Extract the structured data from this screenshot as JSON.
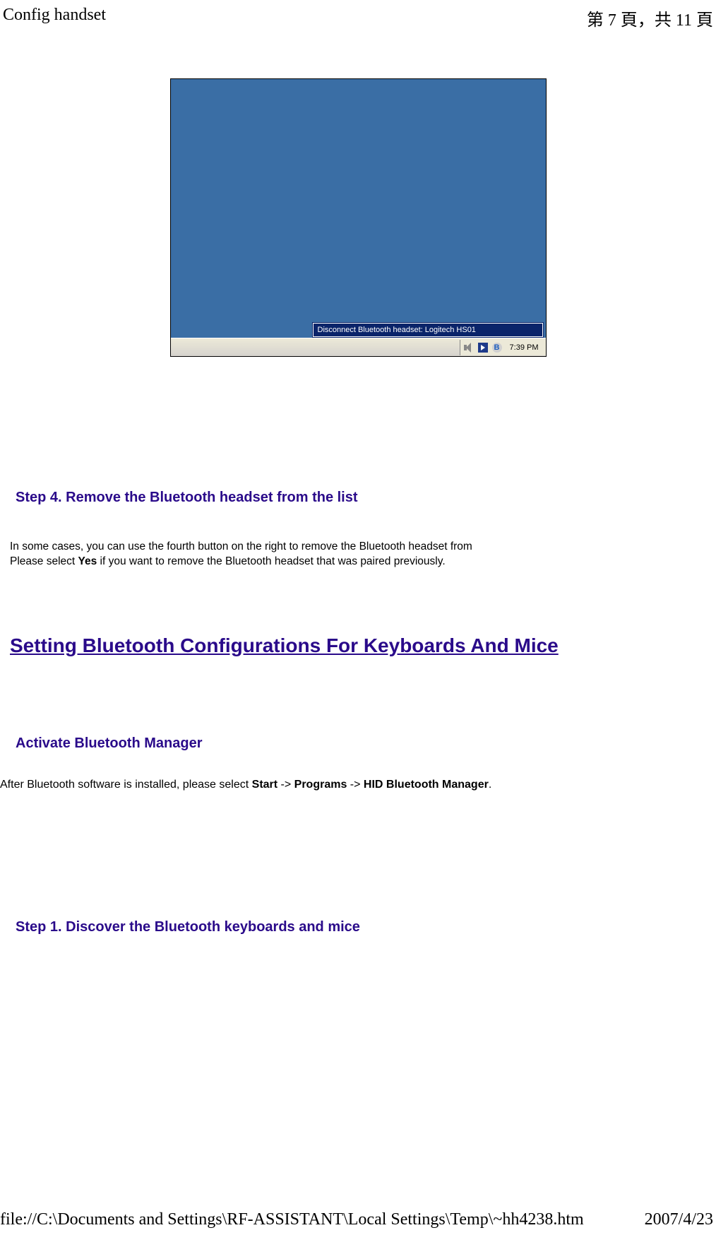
{
  "header": {
    "title": "Config handset",
    "page_indicator": "第 7 頁，共 11 頁"
  },
  "screenshot": {
    "tooltip": "Disconnect Bluetooth headset: Logitech HS01",
    "clock": "7:39 PM"
  },
  "step4": {
    "heading": "Step 4. Remove the Bluetooth headset from the list",
    "text_before_bold": "In some cases, you can use the fourth button on the right to remove the Bluetooth headset from",
    "text_line2_prefix": "Please select ",
    "text_bold": "Yes",
    "text_line2_suffix": " if you want to remove the Bluetooth headset that was paired previously."
  },
  "main_heading": "Setting Bluetooth Configurations For Keyboards And Mice",
  "activate": {
    "heading": "Activate Bluetooth Manager",
    "text_prefix": "After Bluetooth software is installed, please select ",
    "bold1": "Start",
    "arrow": " -> ",
    "bold2": "Programs",
    "bold3": "HID Bluetooth Manager",
    "period": "."
  },
  "step1": {
    "heading": "Step 1. Discover the Bluetooth keyboards and mice"
  },
  "footer": {
    "path": "file://C:\\Documents and Settings\\RF-ASSISTANT\\Local Settings\\Temp\\~hh4238.htm",
    "date": "2007/4/23"
  }
}
